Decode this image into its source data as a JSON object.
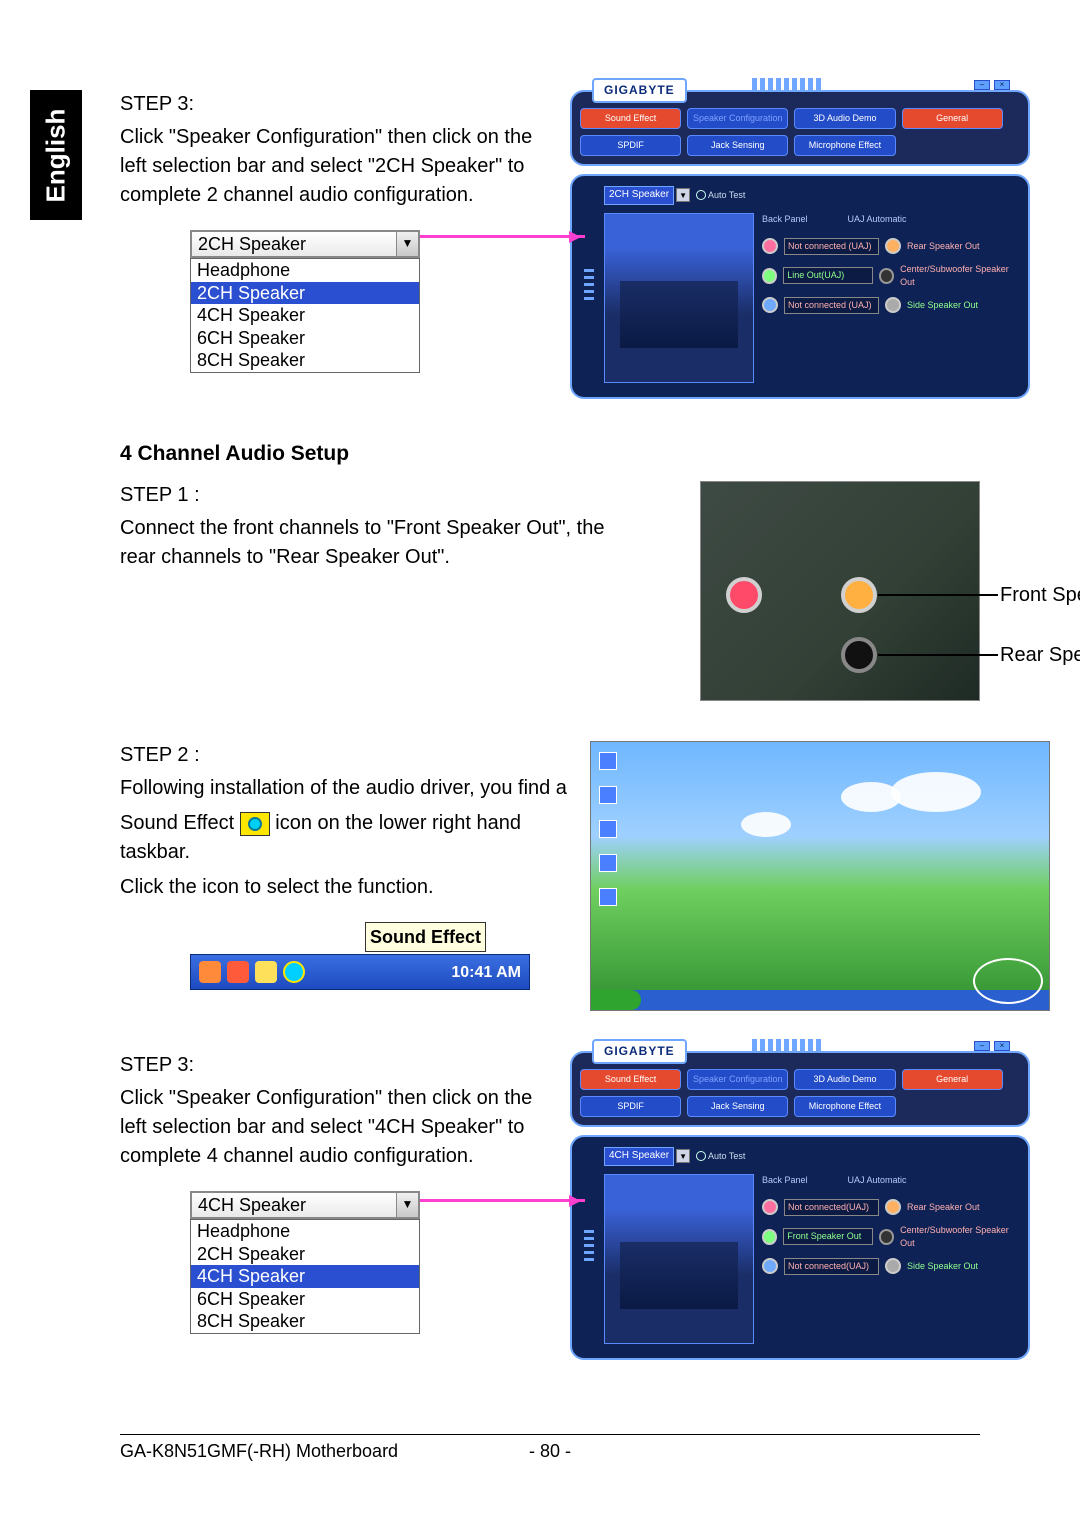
{
  "sidebar": {
    "language": "English"
  },
  "section_2ch": {
    "step3_label": "STEP 3:",
    "step3_body": "Click \"Speaker Configuration\" then click on the left selection bar and select \"2CH Speaker\" to complete 2 channel audio configuration.",
    "combo_selected": "2CH Speaker",
    "combo_options": [
      "Headphone",
      "2CH Speaker",
      "4CH Speaker",
      "6CH Speaker",
      "8CH Speaker"
    ],
    "combo_highlight": "2CH Speaker"
  },
  "gigabyte_panel_1": {
    "logo": "GIGABYTE",
    "tabs": [
      "Sound Effect",
      "Speaker Configuration",
      "3D Audio Demo",
      "General",
      "SPDIF",
      "Jack Sensing",
      "Microphone Effect"
    ],
    "active_tab_index": 1,
    "speaker_mode": "2CH Speaker",
    "auto_test": "Auto Test",
    "back_panel_label": "Back Panel",
    "uaj_label": "UAJ Automatic",
    "jacks_left": [
      "Not connected (UAJ)",
      "Line Out(UAJ)",
      "Not connected (UAJ)"
    ],
    "jacks_right": [
      "Rear Speaker Out",
      "Center/Subwoofer Speaker Out",
      "Side Speaker Out"
    ]
  },
  "section_4ch": {
    "heading": "4 Channel Audio Setup",
    "step1_label": "STEP 1 :",
    "step1_body": "Connect the front channels to \"Front Speaker Out\", the rear channels to \"Rear Speaker Out\".",
    "port_labels": {
      "front": "Front Speaker Out",
      "rear": "Rear Speaker Out"
    },
    "step2_label": "STEP 2 :",
    "step2_body_a": "Following installation of the audio driver, you find a",
    "step2_body_b": "Sound Effect",
    "step2_body_c": "icon on the lower right hand taskbar.",
    "step2_body_d": "Click the icon to select the function.",
    "tooltip": "Sound Effect",
    "tray_time": "10:41 AM",
    "step3_label": "STEP 3:",
    "step3_body": "Click \"Speaker Configuration\" then click on the left selection bar and select \"4CH Speaker\" to complete 4 channel audio configuration.",
    "combo_selected": "4CH Speaker",
    "combo_options": [
      "Headphone",
      "2CH Speaker",
      "4CH Speaker",
      "6CH Speaker",
      "8CH Speaker"
    ],
    "combo_highlight": "4CH Speaker"
  },
  "gigabyte_panel_2": {
    "logo": "GIGABYTE",
    "tabs": [
      "Sound Effect",
      "Speaker Configuration",
      "3D Audio Demo",
      "General",
      "SPDIF",
      "Jack Sensing",
      "Microphone Effect"
    ],
    "active_tab_index": 1,
    "speaker_mode": "4CH Speaker",
    "auto_test": "Auto Test",
    "back_panel_label": "Back Panel",
    "uaj_label": "UAJ Automatic",
    "jacks_left": [
      "Not connected(UAJ)",
      "Front Speaker Out",
      "Not connected(UAJ)"
    ],
    "jacks_right": [
      "Rear Speaker Out",
      "Center/Subwoofer Speaker Out",
      "Side Speaker Out"
    ]
  },
  "footer": {
    "product": "GA-K8N51GMF(-RH) Motherboard",
    "page": "- 80 -"
  }
}
